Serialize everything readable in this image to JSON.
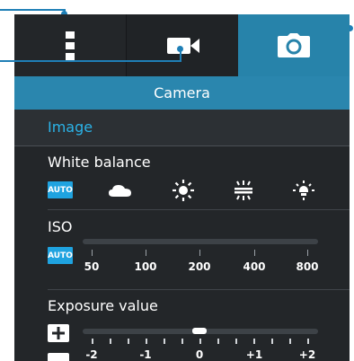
{
  "header": {
    "title": "Camera"
  },
  "section": {
    "title": "Image"
  },
  "white_balance": {
    "label": "White balance",
    "auto_label": "AUTO",
    "options": [
      "cloudy-icon",
      "sunny-icon",
      "fluorescent-icon",
      "incandescent-icon"
    ]
  },
  "iso": {
    "label": "ISO",
    "auto_label": "AUTO",
    "values": [
      "50",
      "100",
      "200",
      "400",
      "800"
    ]
  },
  "exposure": {
    "label": "Exposure value",
    "values": [
      "-2",
      "-1",
      "0",
      "+1",
      "+2"
    ],
    "current": "0"
  },
  "tabs": [
    "menu-dots-icon",
    "video-camera-icon",
    "photo-camera-icon"
  ],
  "colors": {
    "accent": "#2a86ae",
    "auto_chip": "#1fa3e0",
    "section_title": "#2bb3e8",
    "callout": "#1f7fb6"
  }
}
